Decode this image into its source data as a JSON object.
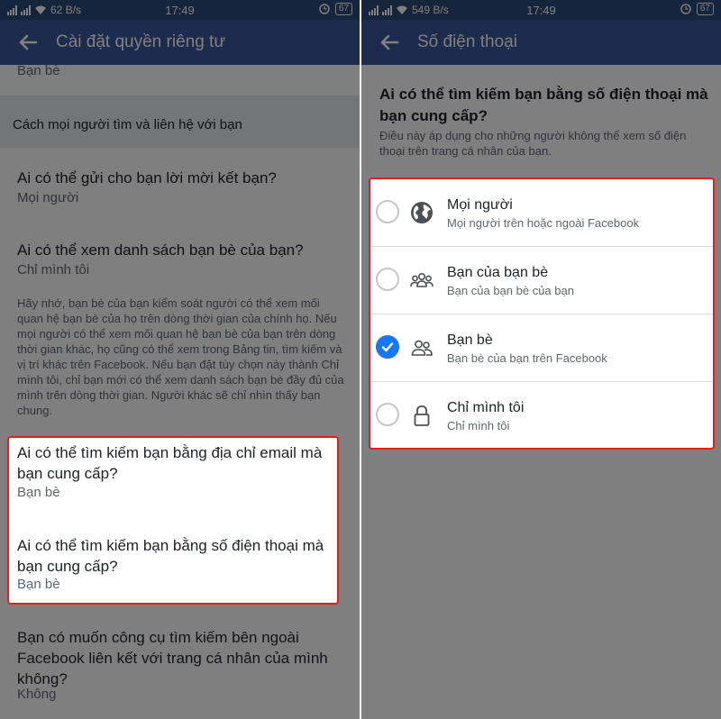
{
  "left": {
    "status": {
      "speed": "62 B/s",
      "time": "17:49",
      "battery": "67"
    },
    "appbar": {
      "title": "Cài đặt quyền riêng tư"
    },
    "top_cut_value": "Bạn bè",
    "section_header": "Cách mọi người tìm và liên hệ với bạn",
    "items": [
      {
        "title": "Ai có thể gửi cho bạn lời mời kết bạn?",
        "value": "Mọi người"
      },
      {
        "title": "Ai có thể xem danh sách bạn bè của bạn?",
        "value": "Chỉ mình tôi"
      },
      {
        "title": "Ai có thể tìm kiếm bạn bằng địa chỉ email mà bạn cung cấp?",
        "value": "Bạn bè"
      },
      {
        "title": "Ai có thể tìm kiếm bạn bằng số điện thoại mà bạn cung cấp?",
        "value": "Bạn bè"
      },
      {
        "title": "Bạn có muốn công cụ tìm kiếm bên ngoài Facebook liên kết với trang cá nhân của mình không?",
        "value": "Không"
      }
    ],
    "note": "Hãy nhớ, bạn bè của bạn kiểm soát người có thể xem mối quan hệ bạn bè của họ trên dòng thời gian của chính họ. Nếu mọi người có thể xem mối quan hệ bạn bè của bạn trên dòng thời gian khác, họ cũng có thể xem trong Bảng tin, tìm kiếm và vị trí khác trên Facebook. Nếu bạn đặt tùy chọn này thành Chỉ mình tôi, chỉ bạn mới có thể xem danh sách bạn bè đầy đủ của mình trên dòng thời gian. Người khác sẽ chỉ nhìn thấy bạn chung."
  },
  "right": {
    "status": {
      "speed": "549 B/s",
      "time": "17:49",
      "battery": "67"
    },
    "appbar": {
      "title": "Số điện thoại"
    },
    "question": "Ai có thể tìm kiếm bạn bằng số điện thoại mà bạn cung cấp?",
    "description": "Điều này áp dụng cho những người không thể xem số điện thoại trên trang cá nhân của bạn.",
    "options": [
      {
        "title": "Mọi người",
        "subtitle": "Mọi người trên hoặc ngoài Facebook",
        "icon": "globe-icon",
        "checked": false
      },
      {
        "title": "Bạn của bạn bè",
        "subtitle": "Bạn của bạn bè của bạn",
        "icon": "friends-of-friends-icon",
        "checked": false
      },
      {
        "title": "Bạn bè",
        "subtitle": "Bạn bè của bạn trên Facebook",
        "icon": "friends-icon",
        "checked": true
      },
      {
        "title": "Chỉ mình tôi",
        "subtitle": "Chỉ mình tôi",
        "icon": "lock-icon",
        "checked": false
      }
    ]
  },
  "colors": {
    "appbar": "#3b5998",
    "statusbar": "#2f4a78",
    "accent": "#1877f2",
    "highlight": "#e02020"
  }
}
